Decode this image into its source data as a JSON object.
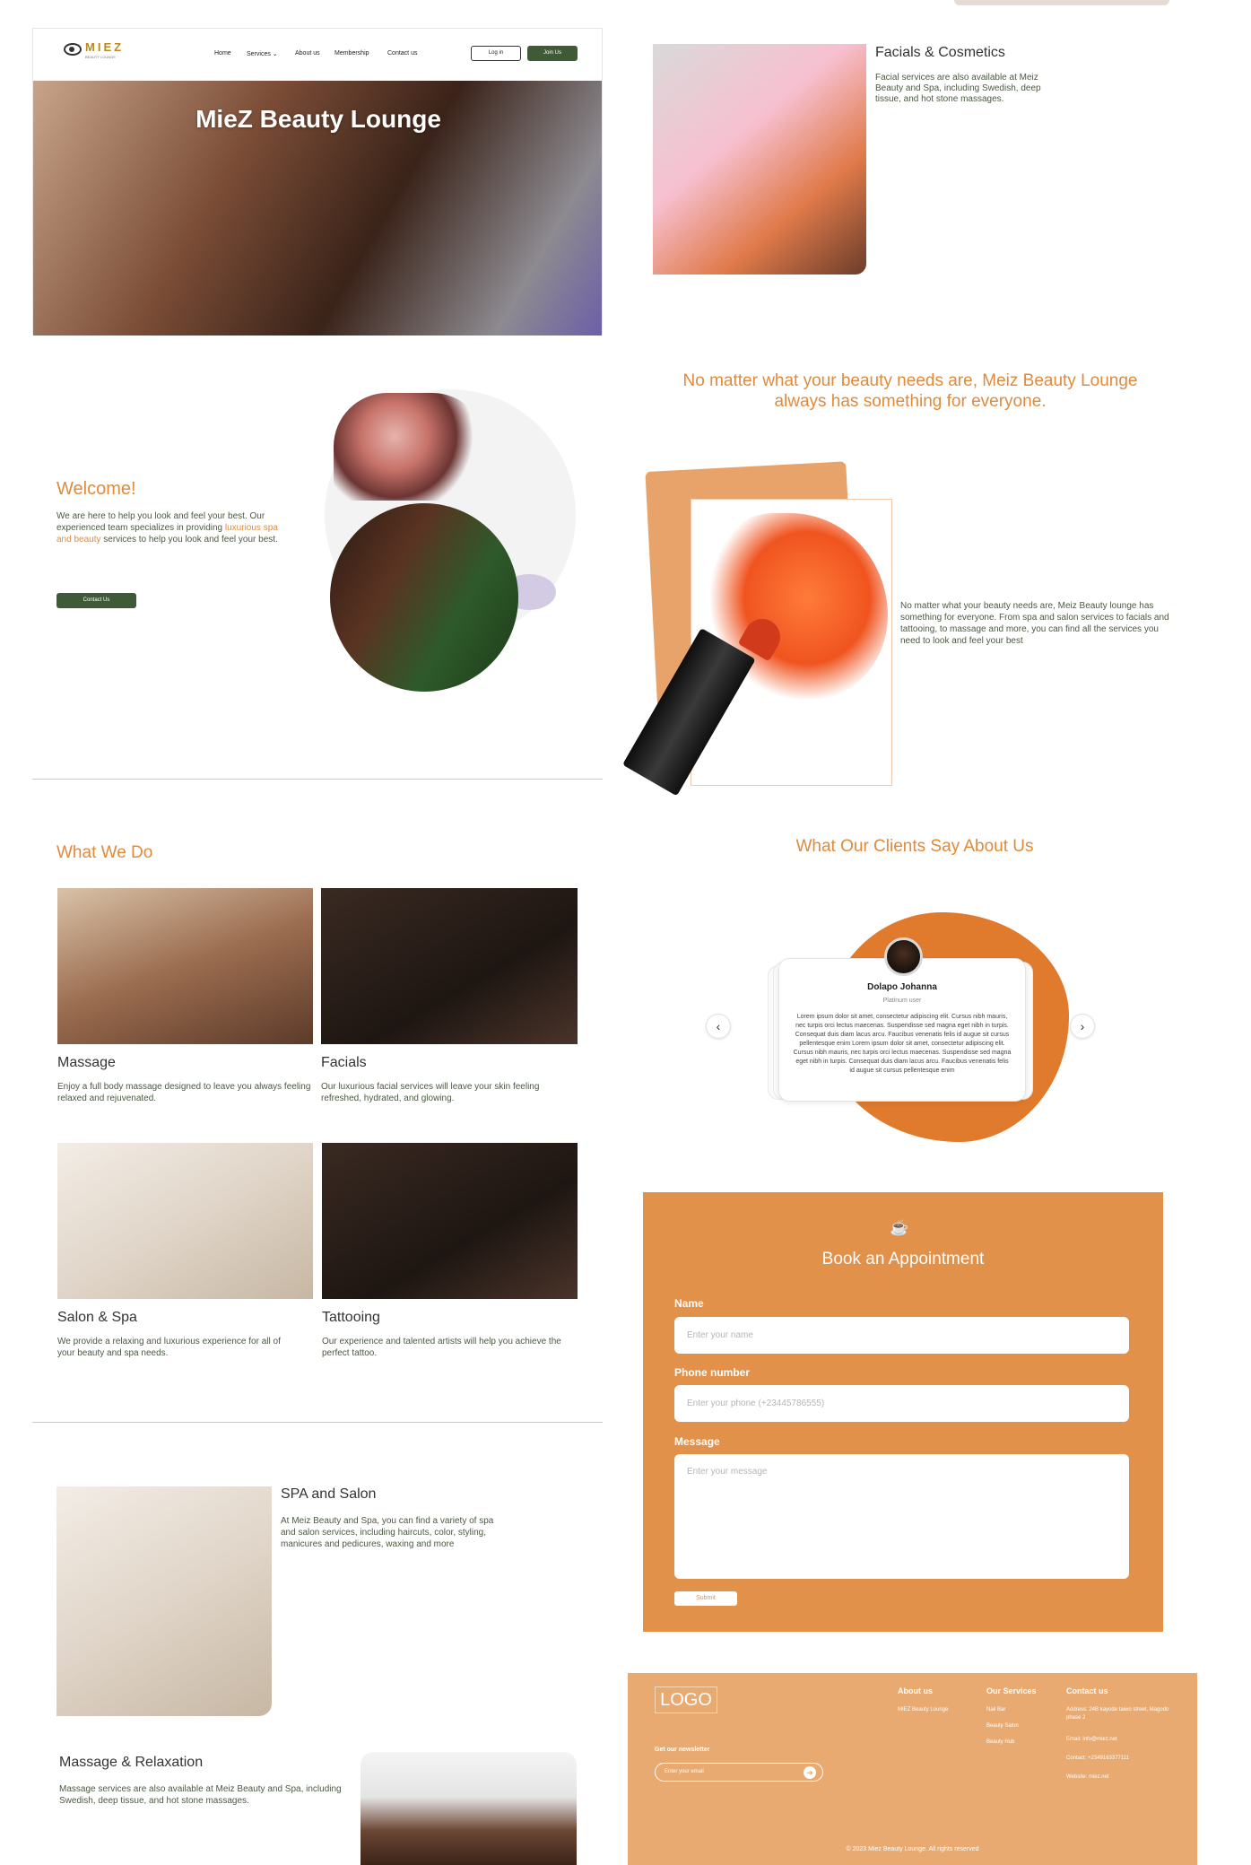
{
  "hero": {
    "logo_text": "MIEZ",
    "logo_subtext": "BEAUTY LOUNGE",
    "nav": [
      "Home",
      "Services",
      "About us",
      "Membership",
      "Contact us"
    ],
    "login_label": "Log in",
    "join_label": "Join Us",
    "title": "MieZ Beauty Lounge"
  },
  "welcome": {
    "title": "Welcome!",
    "text_1": "We are here to help you look and feel your best. Our experienced team specializes in providing",
    "text_highlight": "luxurious spa and beauty",
    "text_2": "services to help you look and feel your best.",
    "button": "Contact Us"
  },
  "what_we_do": {
    "title": "What We Do",
    "services": [
      {
        "title": "Massage",
        "text": "Enjoy a full body massage designed to leave you always feeling relaxed and rejuvenated."
      },
      {
        "title": "Facials",
        "text": "Our luxurious facial services will leave your skin feeling refreshed, hydrated, and glowing."
      },
      {
        "title": "Salon & Spa",
        "text": "We provide a relaxing and luxurious experience for all of your beauty and spa needs."
      },
      {
        "title": "Tattooing",
        "text": "Our experience and talented artists will help you achieve the perfect tattoo."
      }
    ]
  },
  "spa_salon": {
    "title": "SPA and Salon",
    "text": "At Meiz Beauty and Spa, you can find a variety of spa and salon services, including haircuts, color, styling, manicures and pedicures, waxing and more"
  },
  "massage_relaxation": {
    "title": "Massage & Relaxation",
    "text": "Massage services are also available at Meiz Beauty and Spa, including Swedish, deep tissue, and hot stone massages."
  },
  "facials_cosmetics": {
    "title": "Facials & Cosmetics",
    "text": "Facial services are also available at Meiz Beauty and Spa, including Swedish, deep tissue, and hot stone massages."
  },
  "quote": "No matter what your beauty needs are, Meiz Beauty Lounge always has something for everyone.",
  "lipstick_text": "No matter what your beauty needs are, Meiz Beauty lounge has something for everyone. From spa and salon services to facials and tattooing, to massage and more, you can find all the services you need to look and feel your best",
  "testimonials": {
    "title": "What Our Clients Say About Us",
    "name": "Dolapo Johanna",
    "role": "Platinum user",
    "text": "Lorem ipsum dolor sit amet, consectetur adipiscing elit. Cursus nibh mauris, nec turpis orci lectus maecenas. Suspendisse sed magna eget nibh in turpis. Consequat duis diam lacus arcu. Faucibus venenatis felis id augue sit cursus pellentesque enim Lorem ipsum dolor sit amet, consectetur adipiscing elit. Cursus nibh mauris, nec turpis orci lectus maecenas. Suspendisse sed magna eget nibh in turpis. Consequat duis diam lacus arcu. Faucibus venenatis felis id augue sit cursus pellentesque enim",
    "prev_icon": "‹",
    "next_icon": "›"
  },
  "booking": {
    "icon": "☕",
    "title": "Book an Appointment",
    "name_label": "Name",
    "name_placeholder": "Enter your name",
    "phone_label": "Phone number",
    "phone_placeholder": "Enter your phone (+23445786555)",
    "message_label": "Message",
    "message_placeholder": "Enter your message",
    "submit": "Submit"
  },
  "footer": {
    "logo": "LOGO",
    "newsletter_label": "Get our newsletter",
    "email_placeholder": "Enter your email",
    "about_title": "About us",
    "about_items": [
      "MIEZ Beauty Lounge"
    ],
    "services_title": "Our Services",
    "services_items": [
      "Nail Bar",
      "Beauty Salon",
      "Beauty Hub"
    ],
    "contact_title": "Contact us",
    "contact_items": [
      "Address: 24B kayode taiwo street, Magodo phase 2",
      "Email: info@miez.net",
      "Contact: +2349163377111",
      "Website: miez.net"
    ],
    "copyright": "© 2023 Miez Beauty Lounge. All rights reserved"
  },
  "colors": {
    "accent_orange": "#e08a3c",
    "brand_green": "#3f5a36",
    "booking_bg": "#e2914b",
    "footer_bg": "#e8aa70"
  }
}
